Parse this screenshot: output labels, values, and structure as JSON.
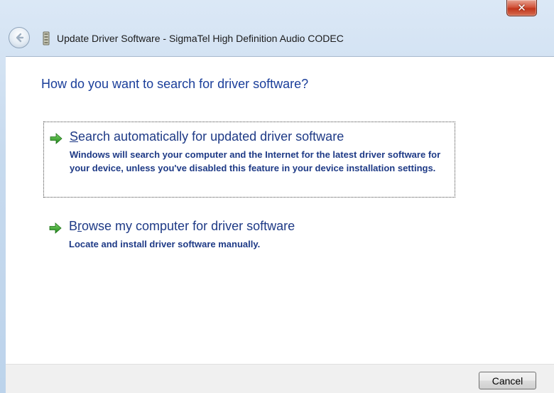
{
  "window": {
    "title": "Update Driver Software - SigmaTel High Definition Audio CODEC",
    "close_glyph": "✕",
    "close_icon": "close-icon",
    "back_icon": "back-arrow-icon",
    "device_icon": "audio-device-icon",
    "close_color": "#c2361c"
  },
  "content": {
    "heading": "How do you want to search for driver software?",
    "accent_color": "#1a3e9a",
    "options": [
      {
        "title_accel": "S",
        "title_rest": "earch automatically for updated driver software",
        "description": "Windows will search your computer and the Internet for the latest driver software for your device, unless you've disabled this feature in your device installation settings.",
        "icon": "green-arrow-icon",
        "selected": true
      },
      {
        "title_pre": "B",
        "title_accel": "r",
        "title_rest": "owse my computer for driver software",
        "description": "Locate and install driver software manually.",
        "icon": "green-arrow-icon",
        "selected": false
      }
    ]
  },
  "footer": {
    "cancel_label": "Cancel"
  }
}
